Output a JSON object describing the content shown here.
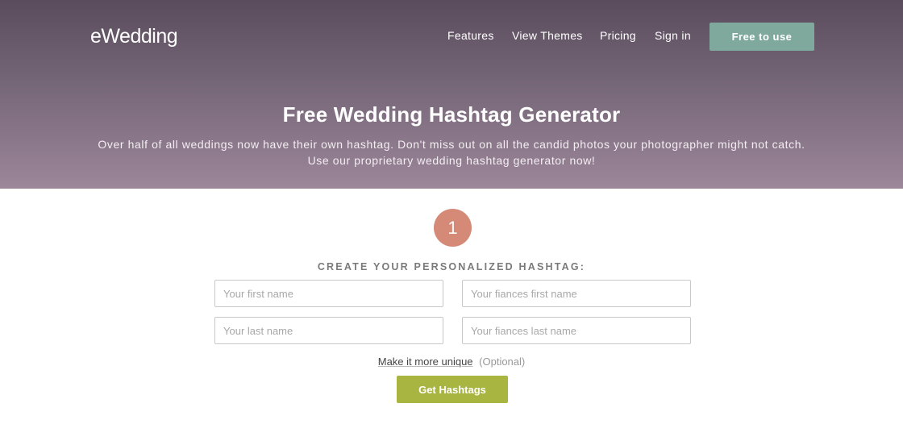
{
  "header": {
    "logo_text": "eWedding",
    "nav": [
      {
        "label": "Features"
      },
      {
        "label": "View Themes"
      },
      {
        "label": "Pricing"
      },
      {
        "label": "Sign in"
      }
    ],
    "cta_label": "Free to use"
  },
  "hero": {
    "title": "Free Wedding Hashtag Generator",
    "subtitle_line1": "Over half of all weddings now have their own hashtag. Don't miss out on all the candid photos your photographer might not catch.",
    "subtitle_line2": "Use our proprietary wedding hashtag generator now!"
  },
  "form": {
    "step_number": "1",
    "heading": "CREATE YOUR PERSONALIZED HASHTAG:",
    "fields": {
      "first_name": {
        "placeholder": "Your first name",
        "value": ""
      },
      "fiance_first_name": {
        "placeholder": "Your fiances first name",
        "value": ""
      },
      "last_name": {
        "placeholder": "Your last name",
        "value": ""
      },
      "fiance_last_name": {
        "placeholder": "Your fiances last name",
        "value": ""
      }
    },
    "unique_link": "Make it more unique",
    "optional_label": "(Optional)",
    "submit_label": "Get Hashtags"
  },
  "colors": {
    "hero_top": "#5a4c5c",
    "hero_bottom": "#9c8699",
    "cta": "#7fa99c",
    "step_circle": "#d58a78",
    "submit": "#a8b541"
  }
}
